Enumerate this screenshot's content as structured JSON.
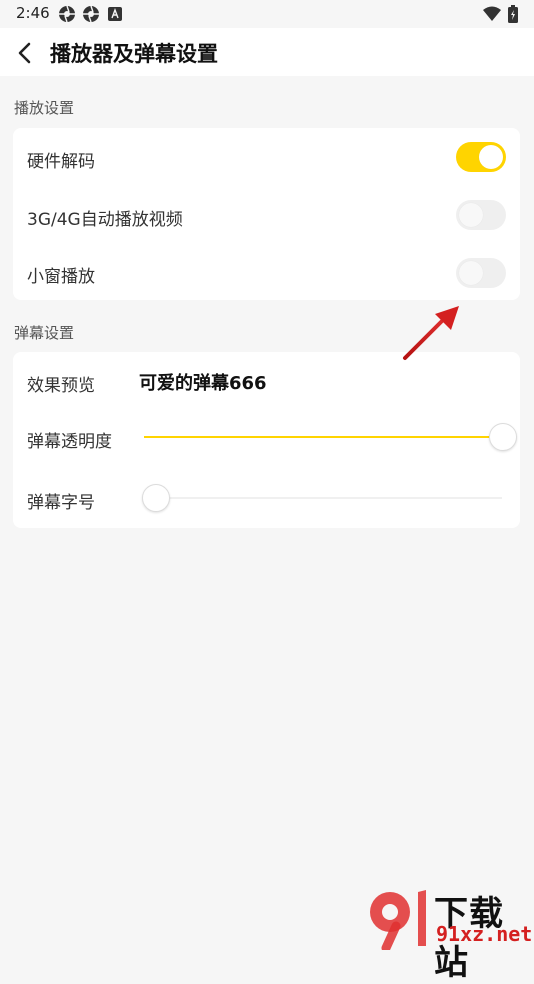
{
  "status_bar": {
    "time": "2:46"
  },
  "header": {
    "title": "播放器及弹幕设置"
  },
  "sections": {
    "playback": {
      "label": "播放设置",
      "items": [
        {
          "label": "硬件解码",
          "on": true
        },
        {
          "label": "3G/4G自动播放视频",
          "on": false
        },
        {
          "label": "小窗播放",
          "on": false
        }
      ]
    },
    "danmaku": {
      "label": "弹幕设置",
      "preview_label": "效果预览",
      "preview_text": "可爱的弹幕666",
      "opacity_label": "弹幕透明度",
      "opacity_value": 1.0,
      "font_size_label": "弹幕字号",
      "font_size_value": 0.0
    }
  },
  "watermark": {
    "brand": "下载站",
    "url": "91xz.net"
  },
  "colors": {
    "accent": "#ffd400",
    "arrow": "#d42020"
  }
}
